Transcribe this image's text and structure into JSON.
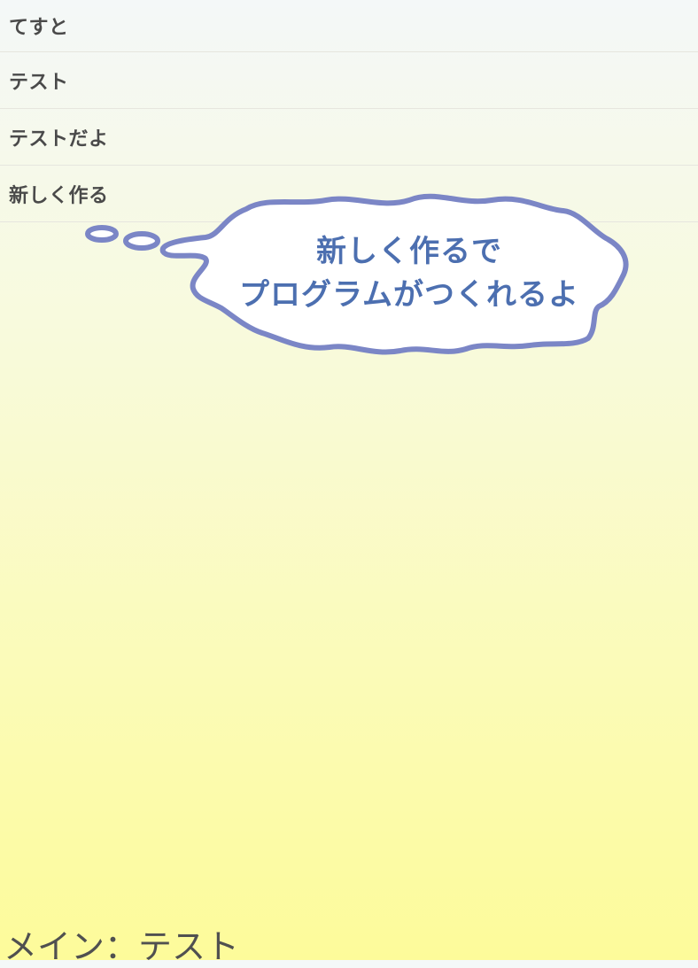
{
  "list": {
    "items": [
      {
        "label": "てすと"
      },
      {
        "label": "テスト"
      },
      {
        "label": "テストだよ"
      },
      {
        "label": "新しく作る"
      }
    ]
  },
  "tooltip": {
    "line1": "新しく作るで",
    "line2": "プログラムがつくれるよ",
    "outline_color": "#7b86c6",
    "text_color": "#4c6fb0"
  },
  "status": {
    "text": "メイン：テスト"
  }
}
